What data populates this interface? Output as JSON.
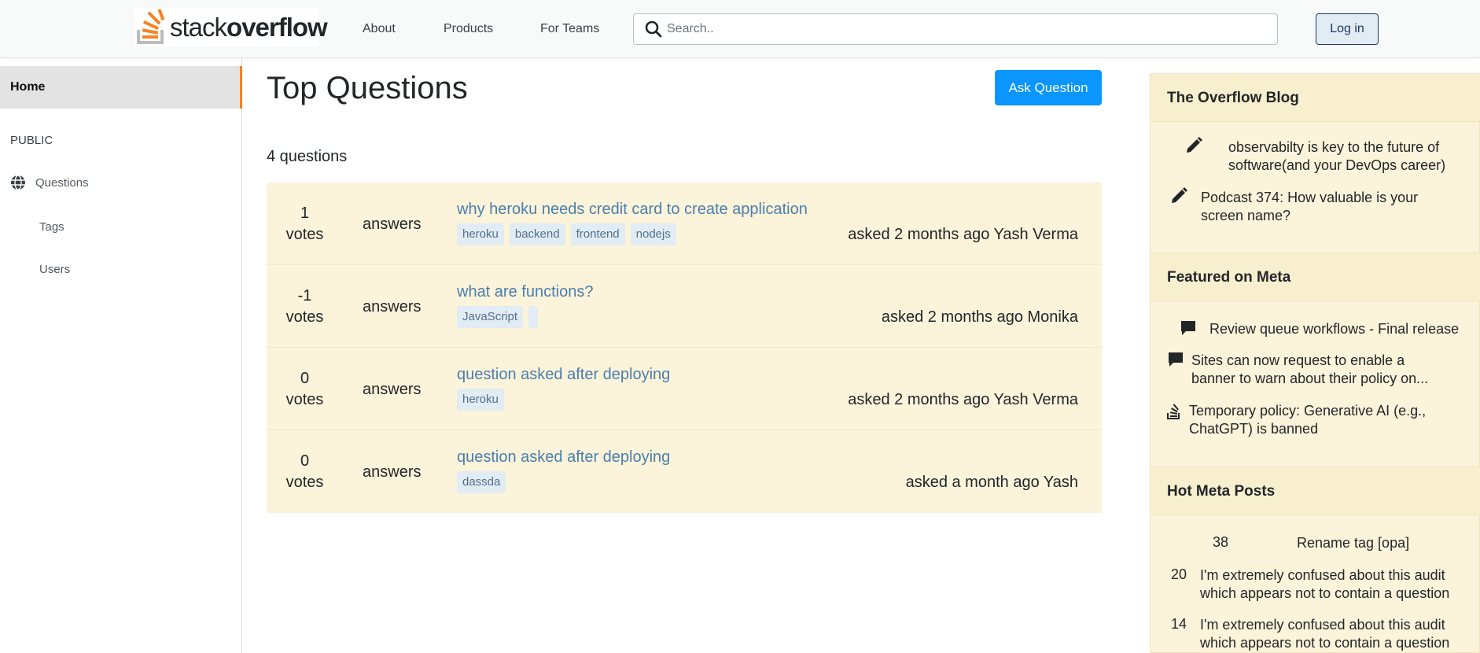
{
  "header": {
    "logo_text_light": "stack",
    "logo_text_bold": "overflow",
    "nav": [
      "About",
      "Products",
      "For Teams"
    ],
    "search_placeholder": "Search..",
    "login_label": "Log in"
  },
  "sidebar": {
    "home": "Home",
    "section": "PUBLIC",
    "items": [
      "Questions",
      "Tags",
      "Users"
    ]
  },
  "main": {
    "title": "Top Questions",
    "ask_button": "Ask Question",
    "count_text": "4 questions",
    "questions": [
      {
        "votes": "1",
        "votes_label": "votes",
        "answers_label": "answers",
        "title": "why heroku needs credit card to create application",
        "tags": [
          "heroku",
          "backend",
          "frontend",
          "nodejs"
        ],
        "asked": "asked 2 months ago Yash Verma"
      },
      {
        "votes": "-1",
        "votes_label": "votes",
        "answers_label": "answers",
        "title": "what are functions?",
        "tags": [
          "JavaScript",
          ""
        ],
        "asked": "asked 2 months ago Monika"
      },
      {
        "votes": "0",
        "votes_label": "votes",
        "answers_label": "answers",
        "title": "question asked after deploying",
        "tags": [
          "heroku"
        ],
        "asked": "asked 2 months ago Yash Verma"
      },
      {
        "votes": "0",
        "votes_label": "votes",
        "answers_label": "answers",
        "title": "question asked after deploying",
        "tags": [
          "dassda"
        ],
        "asked": "asked a month ago Yash"
      }
    ]
  },
  "right_sidebar": {
    "blog_title": "The Overflow Blog",
    "blog_items": [
      "observabilty is key to the future of software(and your DevOps career)",
      "Podcast 374: How valuable is your screen name?"
    ],
    "meta_title": "Featured on Meta",
    "meta_items": [
      "Review queue workflows - Final release",
      "Sites can now request to enable a banner to warn about their policy on...",
      "Temporary policy: Generative AI (e.g., ChatGPT) is banned"
    ],
    "hot_title": "Hot Meta Posts",
    "hot_items": [
      {
        "count": "38",
        "text": "Rename tag [opa]"
      },
      {
        "count": "20",
        "text": "I'm extremely confused about this audit which appears not to contain a question"
      },
      {
        "count": "14",
        "text": "I'm extremely confused about this audit which appears not to contain a question"
      }
    ]
  },
  "colors": {
    "accent": "#f48225",
    "ask_button": "#0a95ff",
    "question_bg": "#fbf3da",
    "link": "#4a7fae"
  }
}
